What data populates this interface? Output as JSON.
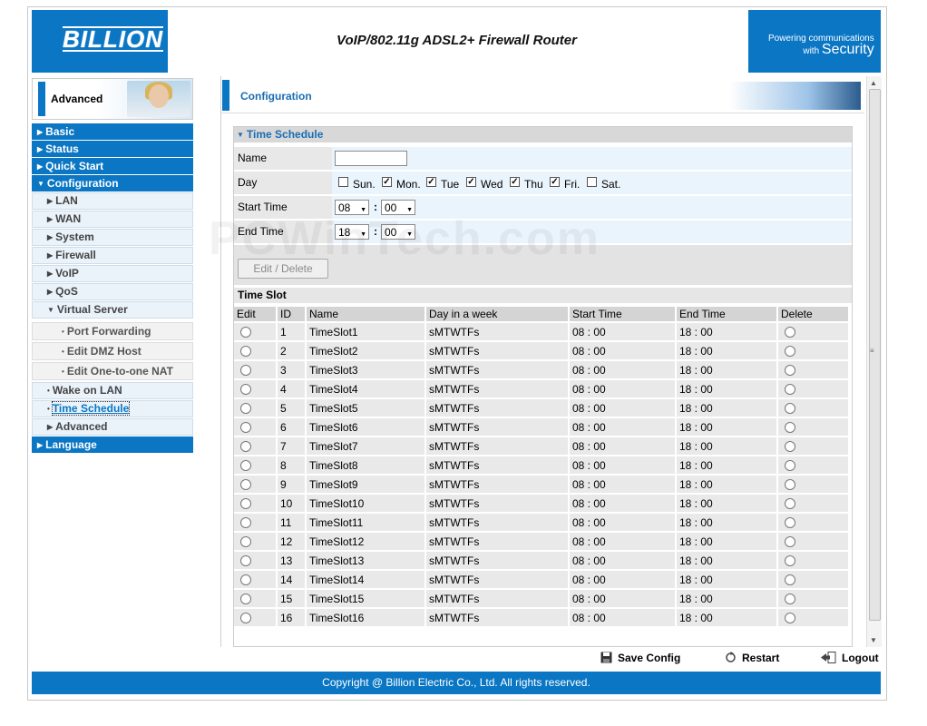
{
  "header": {
    "logo": "BILLION",
    "product_title": "VoIP/802.11g ADSL2+ Firewall Router",
    "tagline_line1": "Powering communications",
    "tagline_line2_small": "with",
    "tagline_line2_big": "Security"
  },
  "sidebar": {
    "section_label": "Advanced",
    "items": [
      {
        "label": "Basic"
      },
      {
        "label": "Status"
      },
      {
        "label": "Quick Start"
      },
      {
        "label": "Configuration"
      },
      {
        "label": "LAN"
      },
      {
        "label": "WAN"
      },
      {
        "label": "System"
      },
      {
        "label": "Firewall"
      },
      {
        "label": "VoIP"
      },
      {
        "label": "QoS"
      },
      {
        "label": "Virtual Server"
      },
      {
        "label": "Port Forwarding"
      },
      {
        "label": "Edit DMZ Host"
      },
      {
        "label": "Edit One-to-one NAT"
      },
      {
        "label": "Wake on LAN"
      },
      {
        "label": "Time Schedule"
      },
      {
        "label": "Advanced"
      },
      {
        "label": "Language"
      }
    ]
  },
  "content": {
    "page_title": "Configuration",
    "section_title": "Time Schedule",
    "form": {
      "name_label": "Name",
      "name_value": "",
      "day_label": "Day",
      "days": [
        {
          "label": "Sun.",
          "checked": false
        },
        {
          "label": "Mon.",
          "checked": true
        },
        {
          "label": "Tue",
          "checked": true
        },
        {
          "label": "Wed",
          "checked": true
        },
        {
          "label": "Thu",
          "checked": true
        },
        {
          "label": "Fri.",
          "checked": true
        },
        {
          "label": "Sat.",
          "checked": false
        }
      ],
      "start_label": "Start Time",
      "start_hour": "08",
      "start_min": "00",
      "end_label": "End Time",
      "end_hour": "18",
      "end_min": "00",
      "colon": ":",
      "edit_delete_button": "Edit / Delete"
    },
    "slot_title": "Time Slot",
    "table": {
      "headers": [
        "Edit",
        "ID",
        "Name",
        "Day in a week",
        "Start Time",
        "End Time",
        "Delete"
      ],
      "rows": [
        {
          "id": "1",
          "name": "TimeSlot1",
          "days": "sMTWTFs",
          "start": "08 : 00",
          "end": "18 : 00"
        },
        {
          "id": "2",
          "name": "TimeSlot2",
          "days": "sMTWTFs",
          "start": "08 : 00",
          "end": "18 : 00"
        },
        {
          "id": "3",
          "name": "TimeSlot3",
          "days": "sMTWTFs",
          "start": "08 : 00",
          "end": "18 : 00"
        },
        {
          "id": "4",
          "name": "TimeSlot4",
          "days": "sMTWTFs",
          "start": "08 : 00",
          "end": "18 : 00"
        },
        {
          "id": "5",
          "name": "TimeSlot5",
          "days": "sMTWTFs",
          "start": "08 : 00",
          "end": "18 : 00"
        },
        {
          "id": "6",
          "name": "TimeSlot6",
          "days": "sMTWTFs",
          "start": "08 : 00",
          "end": "18 : 00"
        },
        {
          "id": "7",
          "name": "TimeSlot7",
          "days": "sMTWTFs",
          "start": "08 : 00",
          "end": "18 : 00"
        },
        {
          "id": "8",
          "name": "TimeSlot8",
          "days": "sMTWTFs",
          "start": "08 : 00",
          "end": "18 : 00"
        },
        {
          "id": "9",
          "name": "TimeSlot9",
          "days": "sMTWTFs",
          "start": "08 : 00",
          "end": "18 : 00"
        },
        {
          "id": "10",
          "name": "TimeSlot10",
          "days": "sMTWTFs",
          "start": "08 : 00",
          "end": "18 : 00"
        },
        {
          "id": "11",
          "name": "TimeSlot11",
          "days": "sMTWTFs",
          "start": "08 : 00",
          "end": "18 : 00"
        },
        {
          "id": "12",
          "name": "TimeSlot12",
          "days": "sMTWTFs",
          "start": "08 : 00",
          "end": "18 : 00"
        },
        {
          "id": "13",
          "name": "TimeSlot13",
          "days": "sMTWTFs",
          "start": "08 : 00",
          "end": "18 : 00"
        },
        {
          "id": "14",
          "name": "TimeSlot14",
          "days": "sMTWTFs",
          "start": "08 : 00",
          "end": "18 : 00"
        },
        {
          "id": "15",
          "name": "TimeSlot15",
          "days": "sMTWTFs",
          "start": "08 : 00",
          "end": "18 : 00"
        },
        {
          "id": "16",
          "name": "TimeSlot16",
          "days": "sMTWTFs",
          "start": "08 : 00",
          "end": "18 : 00"
        }
      ]
    }
  },
  "footer": {
    "save_config": "Save Config",
    "restart": "Restart",
    "logout": "Logout",
    "copyright": "Copyright @ Billion Electric Co., Ltd. All rights reserved."
  },
  "watermark": "PCWinTech.com",
  "colors": {
    "brand_blue": "#0a76c4",
    "link_blue": "#1a6db3"
  }
}
